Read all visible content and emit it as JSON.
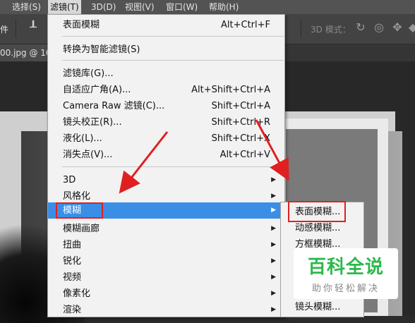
{
  "menubar": {
    "items": [
      {
        "label": "选择(S)"
      },
      {
        "label": "滤镜(T)"
      },
      {
        "label": "3D(D)"
      },
      {
        "label": "视图(V)"
      },
      {
        "label": "窗口(W)"
      },
      {
        "label": "帮助(H)"
      }
    ]
  },
  "optionsbar": {
    "left_text": "件",
    "mode_label": "3D 模式："
  },
  "document": {
    "tab_title": "00.jpg @ 10"
  },
  "filter_menu": {
    "items": [
      {
        "label": "表面模糊",
        "shortcut": "Alt+Ctrl+F"
      },
      {
        "label": "转换为智能滤镜(S)",
        "shortcut": ""
      },
      {
        "label": "滤镜库(G)...",
        "shortcut": ""
      },
      {
        "label": "自适应广角(A)...",
        "shortcut": "Alt+Shift+Ctrl+A"
      },
      {
        "label": "Camera Raw 滤镜(C)...",
        "shortcut": "Shift+Ctrl+A"
      },
      {
        "label": "镜头校正(R)...",
        "shortcut": "Shift+Ctrl+R"
      },
      {
        "label": "液化(L)...",
        "shortcut": "Shift+Ctrl+X"
      },
      {
        "label": "消失点(V)...",
        "shortcut": "Alt+Ctrl+V"
      },
      {
        "label": "3D",
        "shortcut": ""
      },
      {
        "label": "风格化",
        "shortcut": ""
      },
      {
        "label": "模糊",
        "shortcut": ""
      },
      {
        "label": "模糊画廊",
        "shortcut": ""
      },
      {
        "label": "扭曲",
        "shortcut": ""
      },
      {
        "label": "锐化",
        "shortcut": ""
      },
      {
        "label": "视频",
        "shortcut": ""
      },
      {
        "label": "像素化",
        "shortcut": ""
      },
      {
        "label": "渲染",
        "shortcut": ""
      }
    ]
  },
  "blur_submenu": {
    "items": [
      {
        "label": "表面模糊..."
      },
      {
        "label": "动感模糊..."
      },
      {
        "label": "方框模糊..."
      },
      {
        "label": "镜头模糊..."
      }
    ]
  },
  "watermark": {
    "title": "百科全说",
    "subtitle": "助你轻松解决"
  },
  "colors": {
    "highlight": "#3a8ee6",
    "annotation_red": "#e02020",
    "watermark_green": "#2db84d"
  }
}
